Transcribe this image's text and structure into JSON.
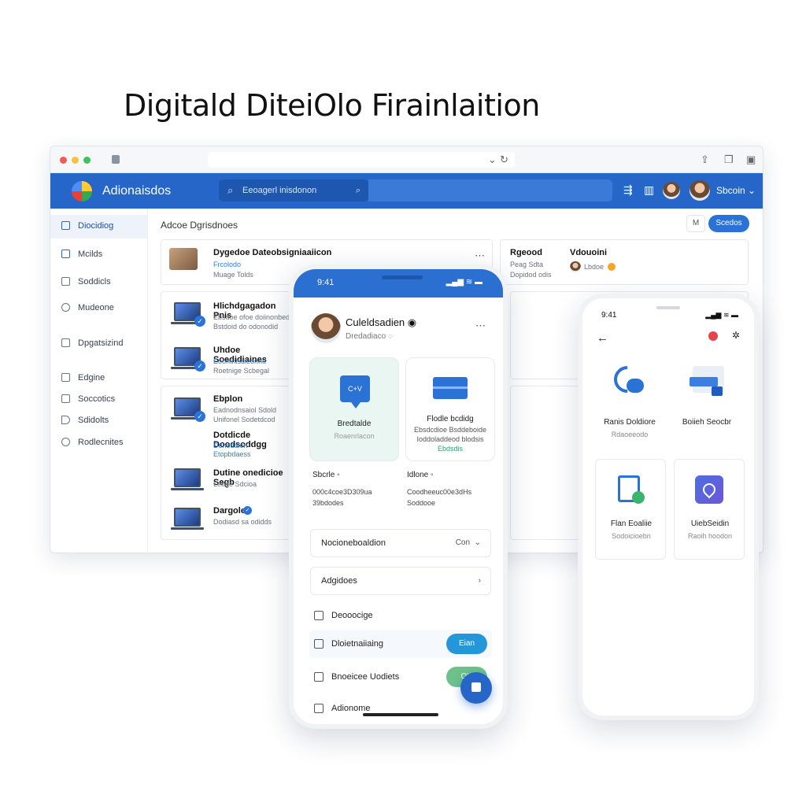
{
  "headline": "Digitald DiteiOlo Firainlaition",
  "browser": {
    "app_name": "Adionaisdos",
    "search_placeholder": "Eeoagerl inisdonon",
    "account_label": "Sbcoin",
    "main_title": "Adcoe Dgrisdnoes",
    "count_button": "M",
    "primary_button": "Scedos",
    "sidebar": [
      {
        "label": "Diocidiog",
        "active": true
      },
      {
        "label": "Mcilds",
        "active": false
      },
      {
        "label": "Soddicls",
        "active": false
      },
      {
        "label": "Mudeone",
        "active": false
      },
      {
        "label": "Dpgatsizind",
        "active": false
      },
      {
        "label": "Edgine",
        "active": false
      },
      {
        "label": "Soccotics",
        "active": false
      },
      {
        "label": "Sdidolts",
        "active": false
      },
      {
        "label": "Rodlecnites",
        "active": false
      }
    ],
    "top_card": {
      "title": "Dygedoe Dateobsigniaaiicon",
      "line1": "Frcolodo",
      "line2": "Muage Tolds"
    },
    "side_card": {
      "col1_title": "Rgeood",
      "col1_line1": "Peag Sdta",
      "col1_line2": "Dopidod odis",
      "col2_title": "Vdouoini",
      "col2_line1": "Lbdoe"
    },
    "items": [
      {
        "title": "Hlichdgagadon Pnis",
        "line1": "Ebsdoe ofoe doiinonbed",
        "line2": "Bstdoid do odonodid"
      },
      {
        "title": "Uhdoe Soedidiaines",
        "line1": "Eoohtnisdieonnd",
        "line2": "Roetnige Scbegal"
      },
      {
        "title": "Ebplon",
        "line1": "Eadnodnsaiol Sdold",
        "line2": "Unifonel Sodetdcod"
      },
      {
        "title": "Dotdicde Doodsoddgg",
        "line1": "Denoddion",
        "line2": "Etopbdaess"
      },
      {
        "title": "Dutine onedicioe Segb",
        "line1": "Lebge Sdcioa",
        "line2": ""
      },
      {
        "title": "Dargole",
        "line1": "Dodiasd sa odidds",
        "line2": ""
      }
    ]
  },
  "phone1": {
    "time": "9:41",
    "signal": "▂▄▆ ≋ ▬",
    "profile_name": "Culeldsadien",
    "profile_sub": "Dredadiaco",
    "tile_a_title": "Bredtalde",
    "tile_a_sub": "Roaenrlacon",
    "tile_a_icon_text": "C+V",
    "tile_b_title": "Flodle bcdidg",
    "tile_b_line1": "Ebsdcdioe Bsddeboide",
    "tile_b_line2": "Ioddoladdeod blodsis",
    "tile_b_line3": "Ebdsdis",
    "stat_a_label": "Sbcrle",
    "stat_a_v1": "000c4coe3D309ua",
    "stat_a_v2": "39bdodes",
    "stat_b_label": "Idlone",
    "stat_b_v1": "Coodheeuc00e3dHs",
    "stat_b_v2": "Soddooe",
    "select_label": "Nocioneboaldion",
    "select_value": "Con",
    "link_row": "Adgidoes",
    "rows": [
      {
        "label": "Deooocige",
        "button": ""
      },
      {
        "label": "Dloietnaiiaing",
        "button": "Eian"
      },
      {
        "label": "Bnoeicee Uodiets",
        "button": "OU"
      },
      {
        "label": "Adionome",
        "button": ""
      }
    ]
  },
  "phone2": {
    "time": "9:41",
    "signal": "▂▄▆ ≋ ▬",
    "features": [
      {
        "title": "Ranis Doldiore",
        "sub": "Rdaoeeodo"
      },
      {
        "title": "Boiieh Seocbr",
        "sub": ""
      },
      {
        "title": "Flan Eoaliie",
        "sub": "Sodoicioebn"
      },
      {
        "title": "UiebSeidin",
        "sub": "Raoih hoodon"
      }
    ]
  }
}
